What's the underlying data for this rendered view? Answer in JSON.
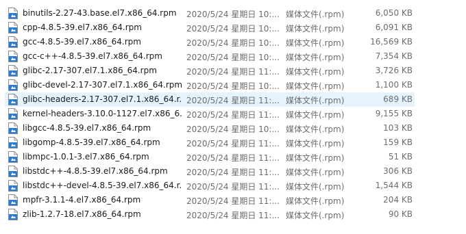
{
  "accent_colors": {
    "selection": "#e5f3ff",
    "icon_blue": "#2b7cd3"
  },
  "file_icon": "rpm-file-icon",
  "files": [
    {
      "name": "binutils-2.27-43.base.el7.x86_64.rpm",
      "date": "2020/5/24 星期日 10:...",
      "type": "媒体文件(.rpm)",
      "size": "6,050 KB"
    },
    {
      "name": "cpp-4.8.5-39.el7.x86_64.rpm",
      "date": "2020/5/24 星期日 10:...",
      "type": "媒体文件(.rpm)",
      "size": "6,091 KB"
    },
    {
      "name": "gcc-4.8.5-39.el7.x86_64.rpm",
      "date": "2020/5/24 星期日 10:...",
      "type": "媒体文件(.rpm)",
      "size": "16,569 KB"
    },
    {
      "name": "gcc-c++-4.8.5-39.el7.x86_64.rpm",
      "date": "2020/5/24 星期日 10:...",
      "type": "媒体文件(.rpm)",
      "size": "7,354 KB"
    },
    {
      "name": "glibc-2.17-307.el7.1.x86_64.rpm",
      "date": "2020/5/24 星期日 11:...",
      "type": "媒体文件(.rpm)",
      "size": "3,726 KB"
    },
    {
      "name": "glibc-devel-2.17-307.el7.1.x86_64.rpm",
      "date": "2020/5/24 星期日 10:...",
      "type": "媒体文件(.rpm)",
      "size": "1,100 KB"
    },
    {
      "name": "glibc-headers-2.17-307.el7.1.x86_64.r...",
      "date": "2020/5/24 星期日 11:...",
      "type": "媒体文件(.rpm)",
      "size": "689 KB",
      "selected": true
    },
    {
      "name": "kernel-headers-3.10.0-1127.el7.x86_6...",
      "date": "2020/5/24 星期日 11:...",
      "type": "媒体文件(.rpm)",
      "size": "9,155 KB"
    },
    {
      "name": "libgcc-4.8.5-39.el7.x86_64.rpm",
      "date": "2020/5/24 星期日 10:...",
      "type": "媒体文件(.rpm)",
      "size": "103 KB"
    },
    {
      "name": "libgomp-4.8.5-39.el7.x86_64.rpm",
      "date": "2020/5/24 星期日 11:...",
      "type": "媒体文件(.rpm)",
      "size": "159 KB"
    },
    {
      "name": "libmpc-1.0.1-3.el7.x86_64.rpm",
      "date": "2020/5/24 星期日 11:...",
      "type": "媒体文件(.rpm)",
      "size": "51 KB"
    },
    {
      "name": "libstdc++-4.8.5-39.el7.x86_64.rpm",
      "date": "2020/5/24 星期日 11:...",
      "type": "媒体文件(.rpm)",
      "size": "306 KB"
    },
    {
      "name": "libstdc++-devel-4.8.5-39.el7.x86_64.r...",
      "date": "2020/5/24 星期日 11:...",
      "type": "媒体文件(.rpm)",
      "size": "1,544 KB"
    },
    {
      "name": "mpfr-3.1.1-4.el7.x86_64.rpm",
      "date": "2020/5/24 星期日 11:...",
      "type": "媒体文件(.rpm)",
      "size": "204 KB"
    },
    {
      "name": "zlib-1.2.7-18.el7.x86_64.rpm",
      "date": "2020/5/24 星期日 11:...",
      "type": "媒体文件(.rpm)",
      "size": "90 KB"
    }
  ]
}
